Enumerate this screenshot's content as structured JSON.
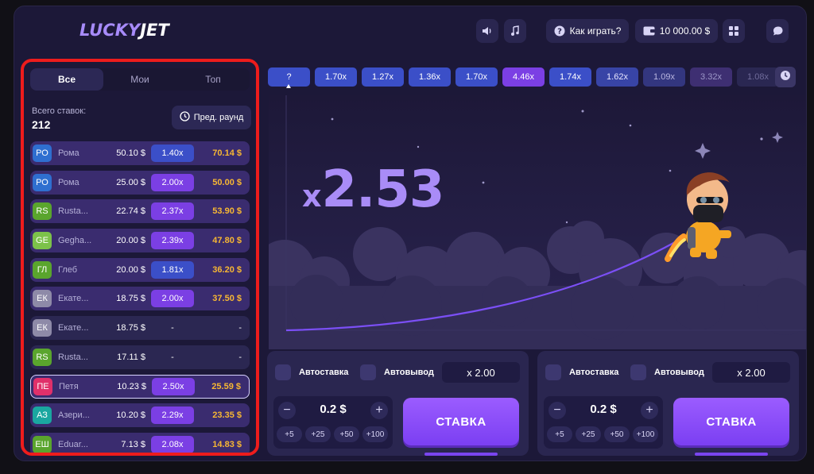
{
  "header": {
    "logo_part1": "LUCKY",
    "logo_part2": "JET",
    "how_to_play": "Как играть?",
    "balance": "10 000.00 $",
    "icons": [
      "sound-icon",
      "music-icon",
      "help-icon",
      "wallet-icon",
      "menu-grid-icon",
      "chat-icon"
    ]
  },
  "bets_panel": {
    "tabs": [
      "Все",
      "Мои",
      "Топ"
    ],
    "total_label": "Всего ставок:",
    "total_value": "212",
    "prev_round_label": "Пред. раунд",
    "rows": [
      {
        "initials": "РО",
        "avatar_color": "#2f6fd0",
        "name": "Рома",
        "bet": "50.10 $",
        "coef": "1.40x",
        "coef_color": "#3b4fc8",
        "win": "70.14 $"
      },
      {
        "initials": "РО",
        "avatar_color": "#2f6fd0",
        "name": "Рома",
        "bet": "25.00 $",
        "coef": "2.00x",
        "coef_color": "#7b3fe4",
        "win": "50.00 $"
      },
      {
        "initials": "RS",
        "avatar_color": "#5aa52d",
        "name": "Rusta...",
        "bet": "22.74 $",
        "coef": "2.37x",
        "coef_color": "#7b3fe4",
        "win": "53.90 $"
      },
      {
        "initials": "GE",
        "avatar_color": "#7cc24a",
        "name": "Gegha...",
        "bet": "20.00 $",
        "coef": "2.39x",
        "coef_color": "#7b3fe4",
        "win": "47.80 $"
      },
      {
        "initials": "ГЛ",
        "avatar_color": "#5aa52d",
        "name": "Глеб",
        "bet": "20.00 $",
        "coef": "1.81x",
        "coef_color": "#3b4fc8",
        "win": "36.20 $"
      },
      {
        "initials": "ЕК",
        "avatar_color": "#8e8aa8",
        "name": "Екате...",
        "bet": "18.75 $",
        "coef": "2.00x",
        "coef_color": "#7b3fe4",
        "win": "37.50 $"
      },
      {
        "initials": "ЕК",
        "avatar_color": "#8e8aa8",
        "name": "Екате...",
        "bet": "18.75 $",
        "coef": "-",
        "coef_color": "",
        "win": "-"
      },
      {
        "initials": "RS",
        "avatar_color": "#5aa52d",
        "name": "Rusta...",
        "bet": "17.11 $",
        "coef": "-",
        "coef_color": "",
        "win": "-"
      },
      {
        "initials": "ПЕ",
        "avatar_color": "#e0306a",
        "name": "Петя",
        "bet": "10.23 $",
        "coef": "2.50x",
        "coef_color": "#7b3fe4",
        "win": "25.59 $"
      },
      {
        "initials": "АЗ",
        "avatar_color": "#1aa7a0",
        "name": "Азери...",
        "bet": "10.20 $",
        "coef": "2.29x",
        "coef_color": "#7b3fe4",
        "win": "23.35 $"
      },
      {
        "initials": "ЕШ",
        "avatar_color": "#5aa52d",
        "name": "Eduar...",
        "bet": "7.13 $",
        "coef": "2.08x",
        "coef_color": "#7b3fe4",
        "win": "14.83 $"
      }
    ]
  },
  "history": [
    {
      "label": "?",
      "color": "#3b4fc8",
      "text_color": "#ffffff"
    },
    {
      "label": "1.70x",
      "color": "#3b4fc8",
      "text_color": "#ffffff"
    },
    {
      "label": "1.27x",
      "color": "#3b4fc8",
      "text_color": "#ffffff"
    },
    {
      "label": "1.36x",
      "color": "#3b4fc8",
      "text_color": "#ffffff"
    },
    {
      "label": "1.70x",
      "color": "#3b4fc8",
      "text_color": "#ffffff"
    },
    {
      "label": "4.46x",
      "color": "#7b3fe4",
      "text_color": "#ffffff"
    },
    {
      "label": "1.74x",
      "color": "#3b4fc8",
      "text_color": "#ffffff"
    },
    {
      "label": "1.62x",
      "color": "#3844a6",
      "text_color": "#e8e6ff"
    },
    {
      "label": "1.09x",
      "color": "#33367f",
      "text_color": "#b9b6e0"
    },
    {
      "label": "3.32x",
      "color": "#3e2f72",
      "text_color": "#9c97c8"
    },
    {
      "label": "1.08x",
      "color": "#2a2752",
      "text_color": "#6f6b9a"
    }
  ],
  "game": {
    "multiplier_prefix": "x",
    "multiplier_value": "2.53"
  },
  "bet_controls": [
    {
      "autobet_label": "Автоставка",
      "autocashout_label": "Автовывод",
      "cashout_x": "x 2.00",
      "amount": "0.2 $",
      "quick": [
        "+5",
        "+25",
        "+50",
        "+100"
      ],
      "bet_label": "СТАВКА"
    },
    {
      "autobet_label": "Автоставка",
      "autocashout_label": "Автовывод",
      "cashout_x": "x 2.00",
      "amount": "0.2 $",
      "quick": [
        "+5",
        "+25",
        "+50",
        "+100"
      ],
      "bet_label": "СТАВКА"
    }
  ],
  "colors": {
    "background": "#1c1838",
    "accent": "#7b3fe4",
    "win_amount": "#f7b733",
    "highlight_border": "#ee1c1c"
  }
}
